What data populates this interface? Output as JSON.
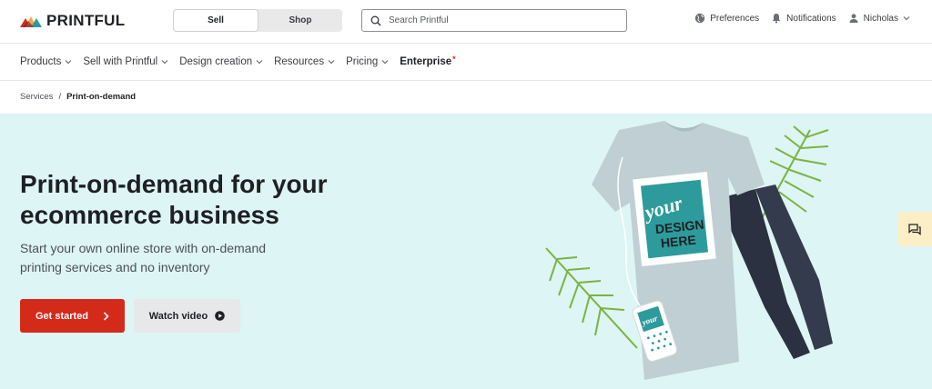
{
  "brand": {
    "name": "PRINTFUL",
    "colors": [
      "#d42a1a",
      "#f2a73b",
      "#2d9b9b"
    ]
  },
  "header": {
    "toggle": {
      "sell_label": "Sell",
      "shop_label": "Shop",
      "active": "Sell"
    },
    "search": {
      "placeholder": "Search Printful",
      "value": ""
    },
    "preferences_label": "Preferences",
    "notifications_label": "Notifications",
    "user_label": "Nicholas"
  },
  "nav": {
    "items": [
      {
        "label": "Products"
      },
      {
        "label": "Sell with Printful"
      },
      {
        "label": "Design creation"
      },
      {
        "label": "Resources"
      },
      {
        "label": "Pricing"
      },
      {
        "label": "Enterprise",
        "marker": "*"
      }
    ]
  },
  "breadcrumb": {
    "parent": "Services",
    "separator": "/",
    "current": "Print-on-demand"
  },
  "hero": {
    "title": "Print-on-demand for your ecommerce business",
    "subtitle": "Start your own online store with on-demand printing services and no inventory",
    "primary_button": "Get started",
    "secondary_button": "Watch video",
    "background_color": "#ddf5f4",
    "tshirt_print": {
      "line1": "your",
      "line2": "DESIGN",
      "line3": "HERE"
    },
    "phone_case_print": "your"
  },
  "icons": {
    "search": "search-icon",
    "globe": "globe-icon",
    "bell": "bell-icon",
    "user": "user-icon",
    "chevron": "chevron-down-icon",
    "arrow": "chevron-right-icon",
    "play": "play-circle-icon",
    "chat": "chat-icon"
  }
}
